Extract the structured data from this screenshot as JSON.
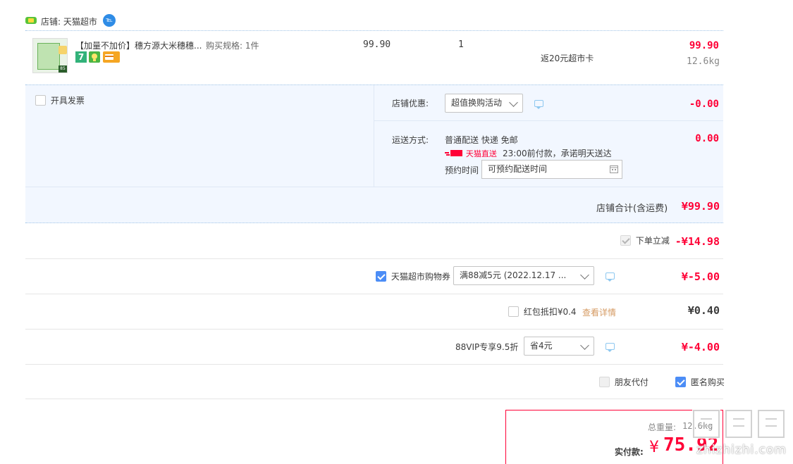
{
  "shop": {
    "label": "店铺: 天猫超市",
    "badge": "℡"
  },
  "item": {
    "title": "【加量不加价】穗方源大米穗穗...",
    "spec": "购买规格: 1件",
    "unit_price": "99.90",
    "quantity": "1",
    "promo": "返20元超市卡",
    "subtotal": "99.90",
    "weight": "12.6kg",
    "badge_seven": "7"
  },
  "invoice": {
    "label": "开具发票"
  },
  "discount": {
    "label": "店铺优惠:",
    "selected": "超值换购活动",
    "amount": "-0.00"
  },
  "shipping": {
    "label": "运送方式:",
    "method": "普通配送 快递 免邮",
    "tmall_direct": "天猫直送",
    "promise": "23:00前付款，承诺明天送达",
    "schedule_label": "预约时间",
    "schedule_placeholder": "可预约配送时间",
    "amount": "0.00"
  },
  "shop_total": {
    "label": "店铺合计(含运费)",
    "amount": "¥99.90"
  },
  "instant_discount": {
    "label": "下单立减",
    "amount": "-¥14.98"
  },
  "coupon": {
    "label": "天猫超市购物券",
    "selected": "满88减5元 (2022.12.17 ...",
    "amount": "¥-5.00"
  },
  "redpacket": {
    "label": "红包抵扣¥0.4",
    "link": "查看详情",
    "amount": "¥0.40"
  },
  "vip": {
    "label": "88VIP专享9.5折",
    "selected": "省4元",
    "amount": "¥-4.00"
  },
  "options": {
    "friend_pay": "朋友代付",
    "anonymous": "匿名购买"
  },
  "summary": {
    "weight_label": "总重量:",
    "weight_value": "12.6kg",
    "pay_label": "实付款:",
    "currency": "¥",
    "pay_amount": "75.92"
  },
  "watermark": {
    "text": "值|值|值",
    "domain": "zhizhizhi.com"
  },
  "colors": {
    "accent_red": "#ff0036",
    "panel_blue": "#f2f7ff",
    "check_blue": "#4c8df6"
  }
}
